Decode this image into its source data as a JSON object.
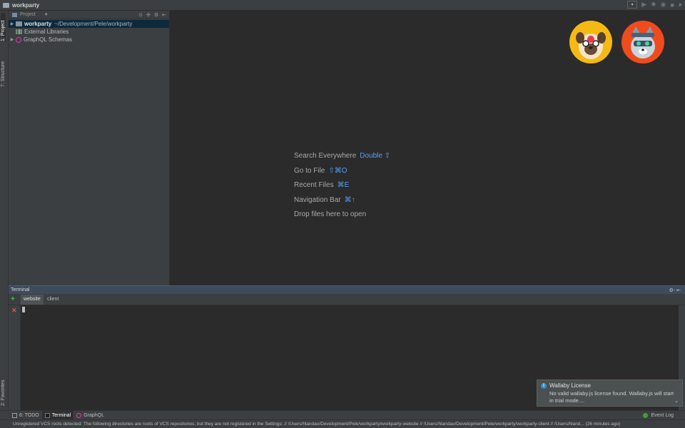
{
  "window": {
    "title": "workparty"
  },
  "left_strip": {
    "tabs": [
      {
        "label": "1: Project"
      },
      {
        "label": "7: Structure"
      },
      {
        "label": "2: Favorites"
      }
    ]
  },
  "project": {
    "view_label": "Project",
    "tree": [
      {
        "name": "workparty",
        "path": "~/Development/Pele/workparty",
        "selected": true,
        "icon": "folder-icon"
      },
      {
        "name": "External Libraries",
        "icon": "library-icon"
      },
      {
        "name": "GraphQL Schemas",
        "icon": "graphql-icon"
      }
    ]
  },
  "editor": {
    "hints": [
      {
        "label": "Search Everywhere",
        "shortcut": "Double ⇧"
      },
      {
        "label": "Go to File",
        "shortcut": "⇧⌘O"
      },
      {
        "label": "Recent Files",
        "shortcut": "⌘E"
      },
      {
        "label": "Navigation Bar",
        "shortcut": "⌘↑"
      },
      {
        "label": "Drop files here to open",
        "shortcut": ""
      }
    ]
  },
  "terminal": {
    "title": "Terminal",
    "tabs": [
      {
        "label": "website"
      },
      {
        "label": "client"
      }
    ],
    "add_symbol": "+",
    "close_symbol": "✕",
    "tools_symbol": "⚙- ⇤"
  },
  "notification": {
    "title": "Wallaby License",
    "body": "No valid wallaby.js license found. Wallaby.js will start in trial mode...."
  },
  "bottom_bar": {
    "tabs": [
      {
        "label": "6: TODO"
      },
      {
        "label": "Terminal"
      },
      {
        "label": "GraphQL"
      }
    ],
    "event_log": "Event Log"
  },
  "status_bar": {
    "text": "Unregistered VCS roots detected: The following directories are roots of VCS repositories, but they are not registered in the Settings: // /Users/hlandao/Development/Pele/workparty/workparty-website // /Users/hlandao/Development/Pele/workparty/workparty-client // /Users/hland... (26 minutes ago)"
  },
  "colors": {
    "accent_blue": "#589df6",
    "selection": "#0d293e",
    "graphql": "#e535ab"
  }
}
